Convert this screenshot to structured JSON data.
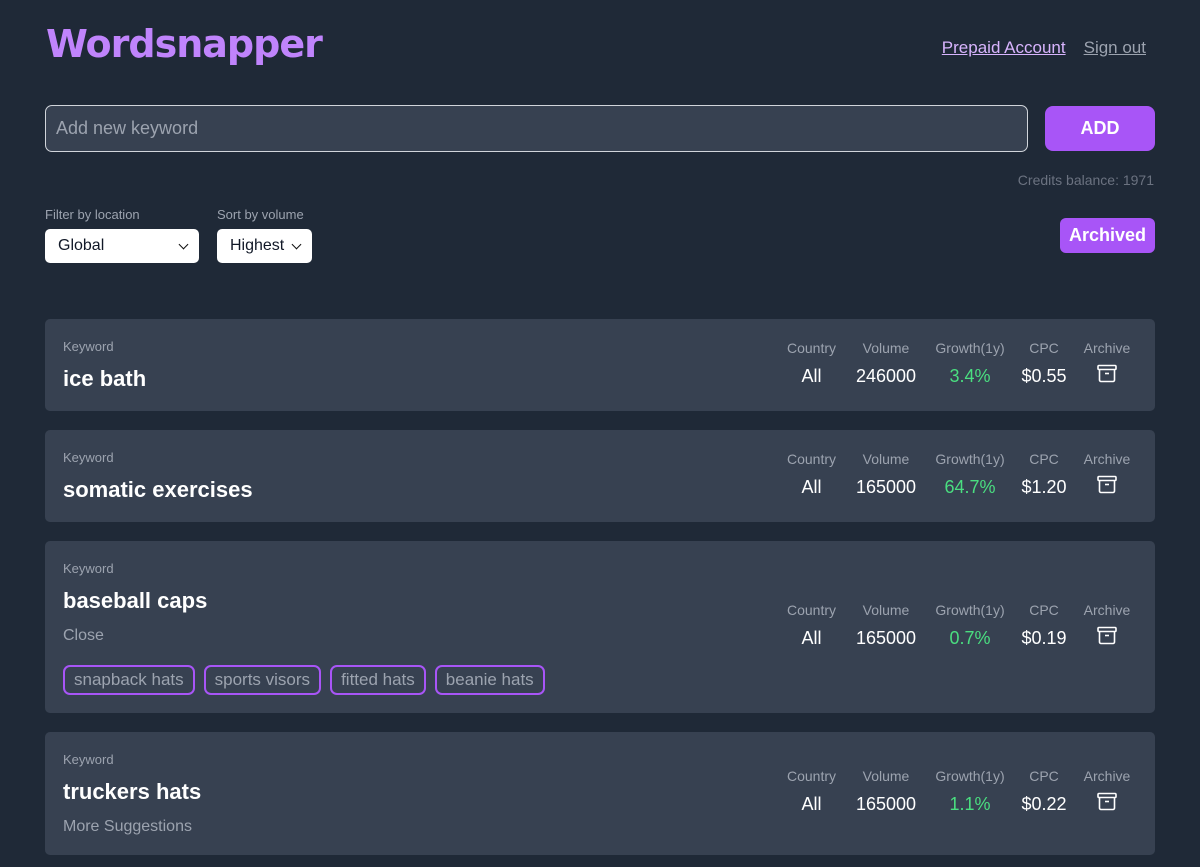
{
  "header": {
    "logo": "Wordsnapper",
    "links": {
      "prepaid": "Prepaid Account",
      "signout": "Sign out"
    }
  },
  "add_form": {
    "placeholder": "Add new keyword",
    "value": "",
    "button": "ADD",
    "credits": "Credits balance: 1971"
  },
  "filters": {
    "location": {
      "label": "Filter by location",
      "selected": "Global"
    },
    "sort": {
      "label": "Sort by volume",
      "selected": "Highest"
    }
  },
  "archived_button": "Archived",
  "columns": {
    "keyword": "Keyword",
    "country": "Country",
    "volume": "Volume",
    "growth": "Growth(1y)",
    "cpc": "CPC",
    "archive": "Archive"
  },
  "keywords": [
    {
      "name": "ice bath",
      "country": "All",
      "volume": "246000",
      "growth": "3.4%",
      "cpc": "$0.55"
    },
    {
      "name": "somatic exercises",
      "country": "All",
      "volume": "165000",
      "growth": "64.7%",
      "cpc": "$1.20"
    },
    {
      "name": "baseball caps",
      "country": "All",
      "volume": "165000",
      "growth": "0.7%",
      "cpc": "$0.19",
      "action": "Close",
      "suggestions": [
        "snapback hats",
        "sports visors",
        "fitted hats",
        "beanie hats"
      ]
    },
    {
      "name": "truckers hats",
      "country": "All",
      "volume": "165000",
      "growth": "1.1%",
      "cpc": "$0.22",
      "action": "More Suggestions"
    }
  ],
  "icons": {
    "archive": "archive-box-icon",
    "chevron": "chevron-down-icon"
  },
  "colors": {
    "accent": "#a855f7",
    "logo": "#c084fc",
    "growth": "#4ade80",
    "background": "#1f2937",
    "card": "#374151"
  }
}
